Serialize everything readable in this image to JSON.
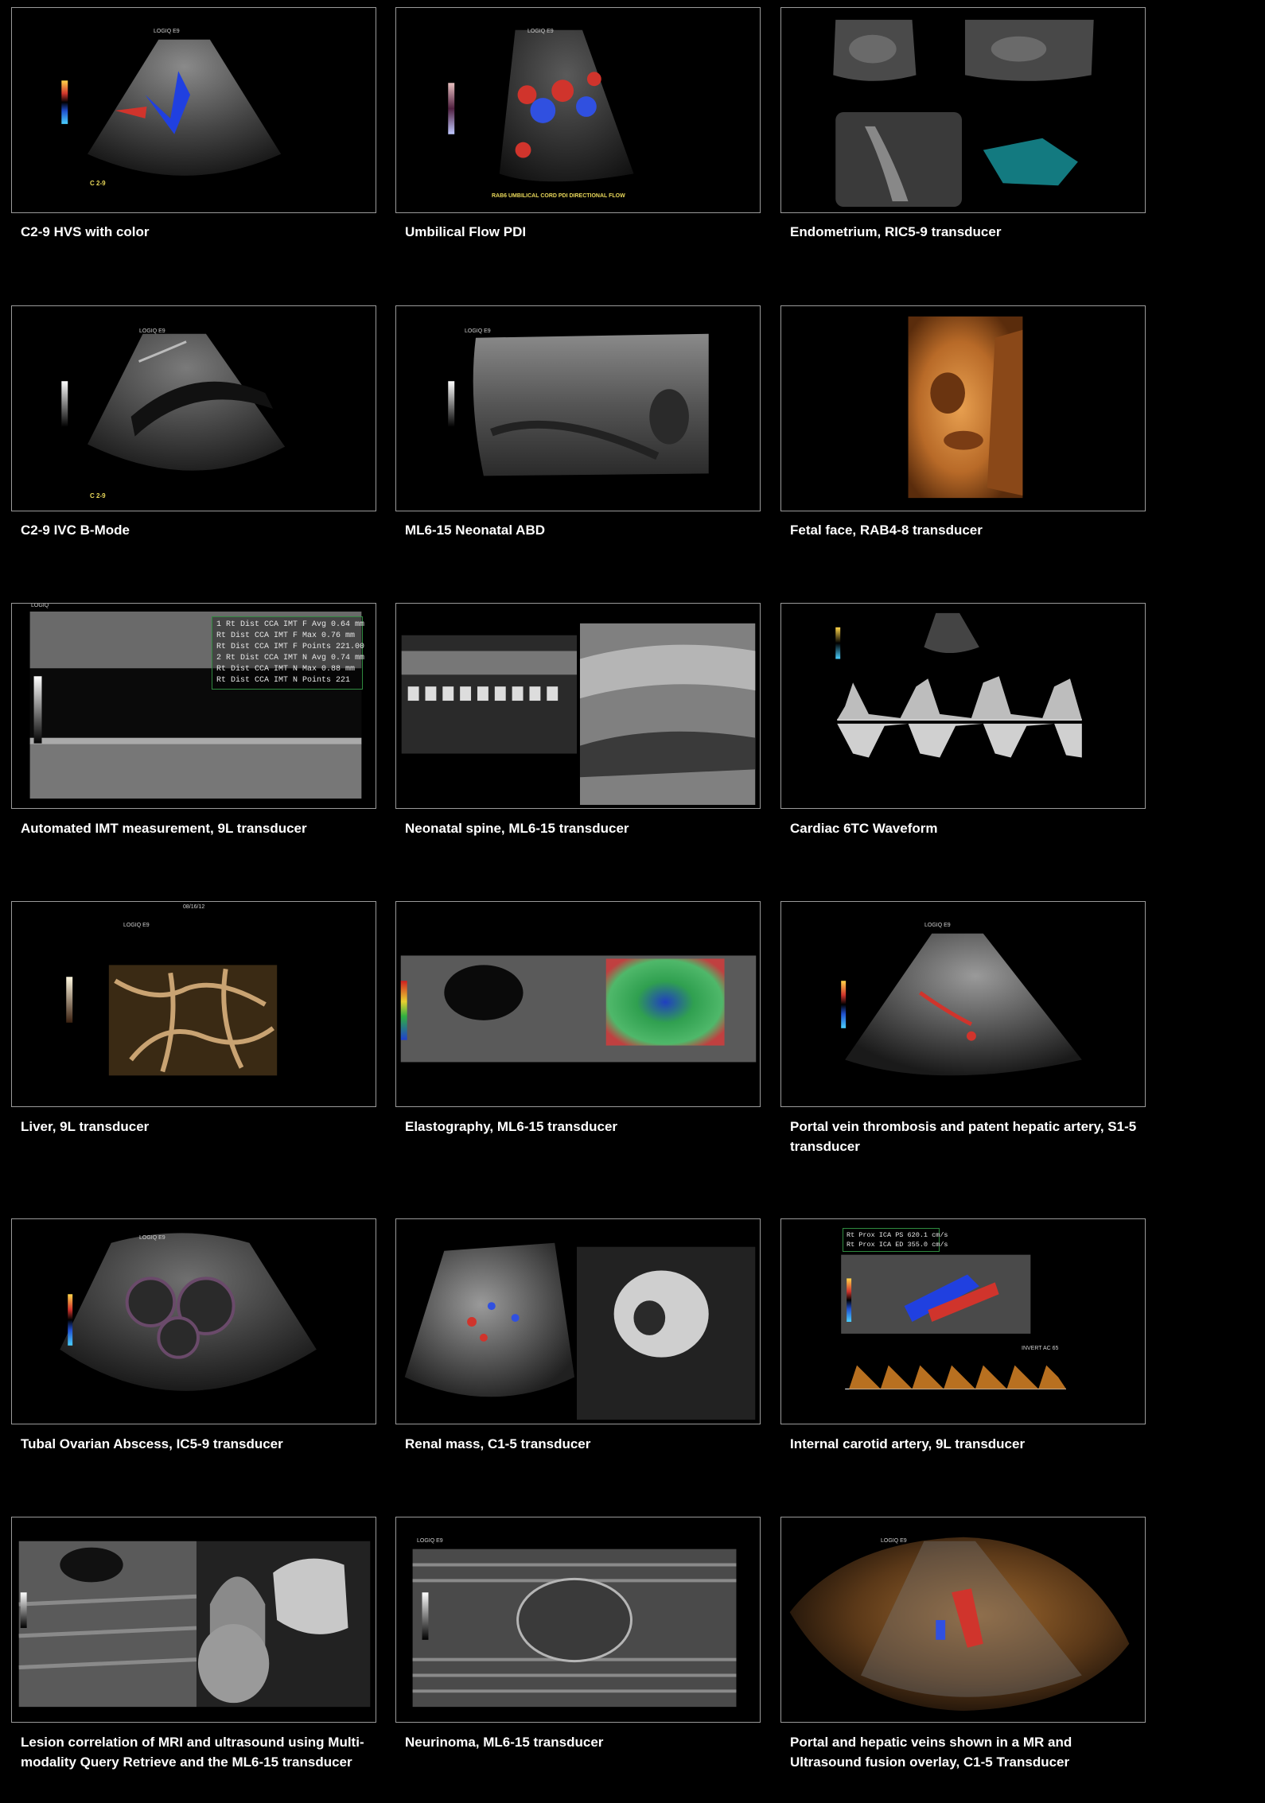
{
  "gallery": [
    {
      "caption": "C2-9 HVS with color",
      "overlay_bottom": "C 2-9",
      "overlay_top": "LOGIQ E9"
    },
    {
      "caption": "Umbilical Flow PDI",
      "overlay_bottom": "RAB6 UMBILICAL CORD PDI DIRECTIONAL FLOW",
      "overlay_top": "LOGIQ E9"
    },
    {
      "caption": "Endometrium, RIC5-9 transducer"
    },
    {
      "caption": "C2-9 IVC B-Mode",
      "overlay_bottom": "C 2-9",
      "overlay_top": "LOGIQ E9"
    },
    {
      "caption": "ML6-15 Neonatal ABD",
      "overlay_top": "LOGIQ E9"
    },
    {
      "caption": "Fetal face, RAB4-8 transducer"
    },
    {
      "caption": "Automated IMT measurement, 9L transducer",
      "overlay_top": "LOGIQ",
      "measurements": [
        "1 Rt Dist  CCA IMT F Avg  0.64 mm",
        "  Rt Dist  CCA IMT F Max  0.76 mm",
        "  Rt Dist  CCA IMT F Points 221.00",
        "2 Rt Dist  CCA IMT N Avg  0.74 mm",
        "  Rt Dist  CCA IMT N Max  0.88 mm",
        "  Rt Dist  CCA IMT N Points   221"
      ]
    },
    {
      "caption": "Neonatal spine, ML6-15 transducer"
    },
    {
      "caption": "Cardiac 6TC Waveform"
    },
    {
      "caption": "Liver, 9L transducer",
      "overlay_date": "08/16/12",
      "overlay_top": "LOGIQ E9"
    },
    {
      "caption": "Elastography, ML6-15 transducer"
    },
    {
      "caption": "Portal vein thrombosis and patent hepatic artery, S1-5 transducer",
      "overlay_top": "LOGIQ E9"
    },
    {
      "caption": "Tubal Ovarian Abscess, IC5-9 transducer",
      "overlay_top": "LOGIQ E9"
    },
    {
      "caption": "Renal mass, C1-5 transducer"
    },
    {
      "caption": "Internal carotid artery, 9L transducer",
      "measurements": [
        "Rt Prox  ICA PS  620.1 cm/s",
        "Rt Prox  ICA ED  355.0 cm/s"
      ],
      "overlay_label": "INVERT  AC 65"
    },
    {
      "caption": "Lesion correlation of MRI and ultrasound using Multi-modality Query Retrieve and the ML6-15 transducer"
    },
    {
      "caption": "Neurinoma, ML6-15 transducer",
      "overlay_top": "LOGIQ E9"
    },
    {
      "caption": "Portal and hepatic veins shown in a MR and Ultrasound fusion overlay, C1-5 Transducer",
      "overlay_top": "LOGIQ E9"
    }
  ]
}
